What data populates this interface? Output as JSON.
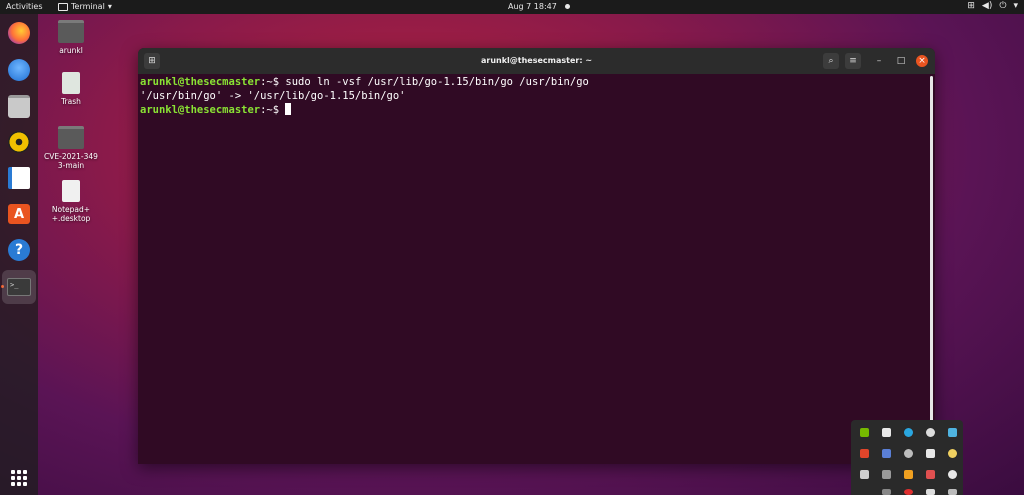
{
  "topbar": {
    "activities": "Activities",
    "app_menu": "Terminal",
    "clock": "Aug 7  18:47"
  },
  "dock": {
    "items": [
      {
        "name": "firefox",
        "icon": "firefox-icon",
        "color": "#ff7139"
      },
      {
        "name": "thunderbird",
        "icon": "mail-icon",
        "color": "#1f6fd1"
      },
      {
        "name": "files",
        "icon": "folder-icon",
        "color": "#b0b0b0"
      },
      {
        "name": "rhythmbox",
        "icon": "music-icon",
        "color": "#f0c000"
      },
      {
        "name": "writer",
        "icon": "document-icon",
        "color": "#2a7bd4"
      },
      {
        "name": "software",
        "icon": "store-icon",
        "color": "#e95420"
      },
      {
        "name": "help",
        "icon": "help-icon",
        "color": "#1f6fd1"
      },
      {
        "name": "terminal",
        "icon": "terminal-icon",
        "color": "#3a3a3a"
      }
    ]
  },
  "desktop": {
    "icons": [
      {
        "label": "arunkl"
      },
      {
        "label": "Trash"
      },
      {
        "label": "CVE-2021-3493-main"
      },
      {
        "label": "Notepad++.desktop"
      }
    ]
  },
  "terminal": {
    "title": "arunkl@thesecmaster: ~",
    "lines": [
      {
        "prompt": "arunkl@thesecmaster",
        "sep": ":~$ ",
        "text": "sudo ln -vsf /usr/lib/go-1.15/bin/go /usr/bin/go"
      },
      {
        "prompt": "",
        "sep": "",
        "text": "'/usr/bin/go' -> '/usr/lib/go-1.15/bin/go'"
      },
      {
        "prompt": "arunkl@thesecmaster",
        "sep": ":~$ ",
        "text": ""
      }
    ]
  },
  "colors": {
    "accent": "#e95420",
    "prompt_green": "#8ae234",
    "terminal_bg": "#300a24"
  }
}
